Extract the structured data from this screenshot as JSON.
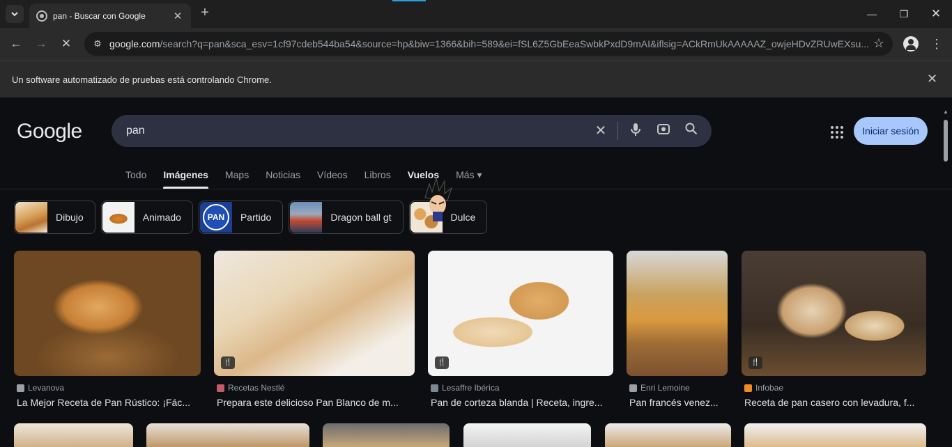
{
  "browser": {
    "tab_title": "pan - Buscar con Google",
    "url_host": "google.com",
    "url_path": "/search?q=pan&sca_esv=1cf97cdeb544ba54&source=hp&biw=1366&bih=589&ei=fSL6Z5GbEeaSwbkPxdD9mAI&iflsig=ACkRmUkAAAAAZ_owjeHDvZRUwEXsu...",
    "infobar_text": "Un software automatizado de pruebas está controlando Chrome."
  },
  "google": {
    "logo": "Google",
    "query": "pan",
    "signin_label": "Iniciar sesión"
  },
  "nav_tabs": [
    "Todo",
    "Imágenes",
    "Maps",
    "Noticias",
    "Vídeos",
    "Libros",
    "Vuelos",
    "Más ▾"
  ],
  "active_tab": "Imágenes",
  "chips": [
    "Dibujo",
    "Animado",
    "Partido",
    "Dragon ball gt",
    "Dulce"
  ],
  "chip_pan_logo": "PAN",
  "results": [
    {
      "source": "Levanova",
      "caption": "La Mejor Receta de Pan Rústico: ¡Fác...",
      "tagged": false
    },
    {
      "source": "Recetas Nestlé",
      "caption": "Prepara este delicioso Pan Blanco de m...",
      "tagged": true
    },
    {
      "source": "Lesaffre Ibérica",
      "caption": "Pan de corteza blanda | Receta, ingre...",
      "tagged": true
    },
    {
      "source": "Enri Lemoine",
      "caption": "Pan francés venez...",
      "tagged": false
    },
    {
      "source": "Infobae",
      "caption": "Receta de pan casero con levadura, f...",
      "tagged": true
    }
  ],
  "colors": {
    "page_bg": "#0d0e12",
    "searchbox_bg": "#2d3142",
    "signin_bg": "#a8c7fa",
    "browser_chrome": "#2b2b2b"
  },
  "icons": {
    "tab_search": "chevron-down-icon",
    "tag": "restaurant-icon"
  }
}
